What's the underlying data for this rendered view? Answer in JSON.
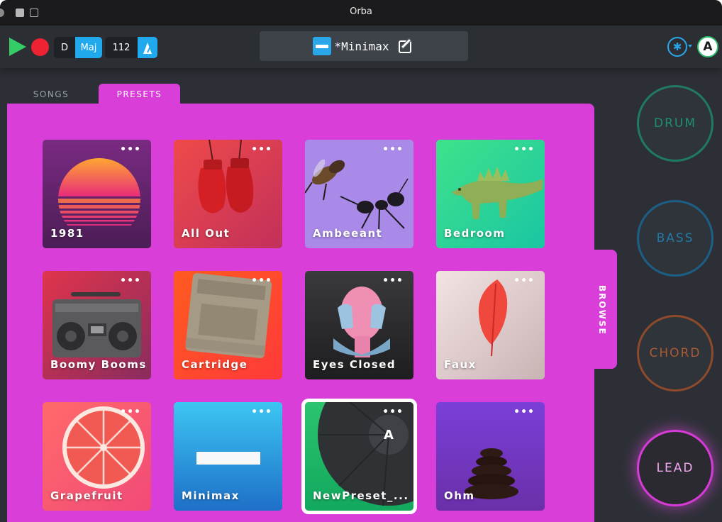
{
  "window": {
    "title": "Orba"
  },
  "toolbar": {
    "key": "D",
    "scale": "Maj",
    "tempo": "112",
    "preset_name": "*Minimax"
  },
  "tabs": [
    {
      "label": "SONGS",
      "active": false
    },
    {
      "label": "PRESETS",
      "active": true
    }
  ],
  "browse_label": "BROWSE",
  "accent_color": "#d93ed8",
  "presets": [
    {
      "name": "1981",
      "dots": "•••"
    },
    {
      "name": "All Out",
      "dots": "•••"
    },
    {
      "name": "Ambeeant",
      "dots": "•••"
    },
    {
      "name": "Bedroom",
      "dots": "•••"
    },
    {
      "name": "Boomy Booms",
      "dots": "•••"
    },
    {
      "name": "Cartridge",
      "dots": "•••"
    },
    {
      "name": "Eyes Closed",
      "dots": "•••"
    },
    {
      "name": "Faux",
      "dots": "•••"
    },
    {
      "name": "Grapefruit",
      "dots": "•••"
    },
    {
      "name": "Minimax",
      "dots": "•••"
    },
    {
      "name": "NewPreset_...",
      "dots": "•••",
      "selected": true
    },
    {
      "name": "Ohm",
      "dots": "•••"
    }
  ],
  "instruments": [
    {
      "label": "DRUM",
      "color": "#1d8f6e"
    },
    {
      "label": "BASS",
      "color": "#2179aa"
    },
    {
      "label": "CHORD",
      "color": "#b05a31"
    },
    {
      "label": "LEAD",
      "color": "#d63bd6",
      "active": true
    }
  ]
}
